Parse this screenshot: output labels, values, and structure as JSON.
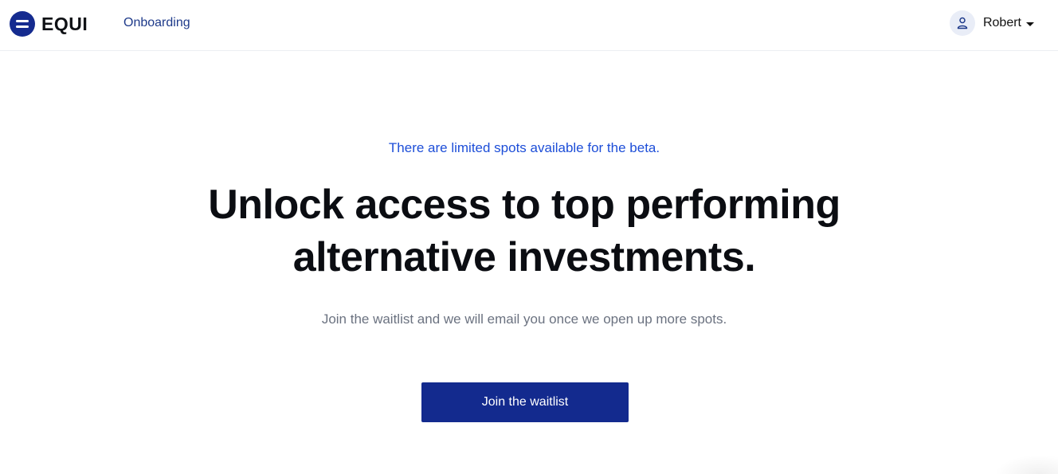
{
  "header": {
    "brand": "EQUI",
    "nav_link": "Onboarding",
    "user_name": "Robert"
  },
  "hero": {
    "eyebrow": "There are limited spots available for the beta.",
    "headline_line1": "Unlock access to top performing",
    "headline_line2": "alternative investments.",
    "subtext": "Join the waitlist and we will email you once we open up more spots.",
    "cta_label": "Join the waitlist"
  },
  "colors": {
    "brand": "#152b8f",
    "eyebrow": "#1d4ed8",
    "nav_link": "#1e3a8a",
    "subtext": "#6b7280"
  },
  "icons": {
    "logo": "equals-circle-logo",
    "avatar": "user-icon",
    "menu_caret": "caret-down-icon"
  }
}
